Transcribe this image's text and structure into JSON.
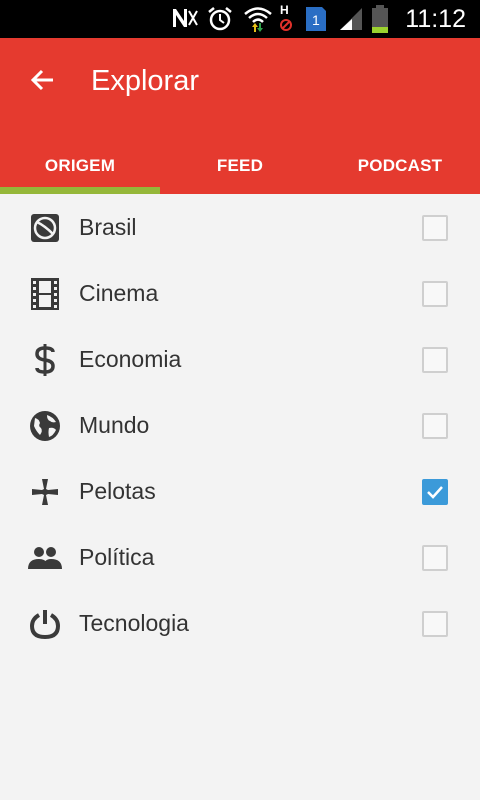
{
  "status_bar": {
    "time": "11:12",
    "icons": [
      "no-notifications-icon",
      "alarm-icon",
      "wifi-icon",
      "h-signal-icon",
      "sim-badge-icon",
      "signal-icon",
      "battery-icon"
    ],
    "sim_badge": "1",
    "h_label": "H"
  },
  "app_bar": {
    "title": "Explorar",
    "back_icon": "arrow-left-icon",
    "color": "#e53a2f"
  },
  "tabs": [
    {
      "label": "ORIGEM",
      "selected": true
    },
    {
      "label": "FEED",
      "selected": false
    },
    {
      "label": "PODCAST",
      "selected": false
    }
  ],
  "tab_indicator_color": "#95b739",
  "categories": [
    {
      "label": "Brasil",
      "icon": "soccer-ball-icon",
      "checked": false
    },
    {
      "label": "Cinema",
      "icon": "film-strip-icon",
      "checked": false
    },
    {
      "label": "Economia",
      "icon": "dollar-icon",
      "checked": false
    },
    {
      "label": "Mundo",
      "icon": "globe-icon",
      "checked": false
    },
    {
      "label": "Pelotas",
      "icon": "cross-icon",
      "checked": true
    },
    {
      "label": "Política",
      "icon": "people-icon",
      "checked": false
    },
    {
      "label": "Tecnologia",
      "icon": "power-icon",
      "checked": false
    }
  ],
  "checkbox_checked_color": "#3b9ad9"
}
